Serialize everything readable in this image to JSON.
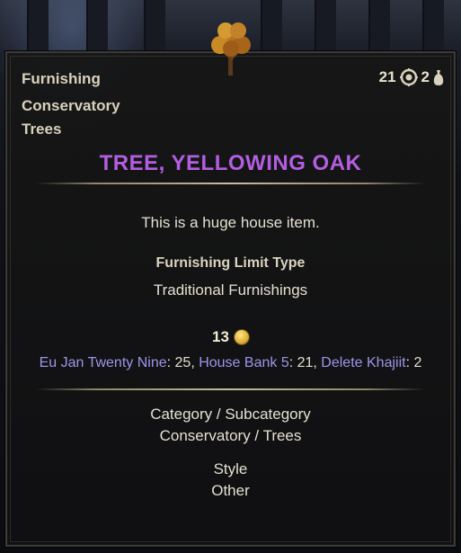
{
  "colors": {
    "title": "#b35ee0",
    "body_text": "#e4e0cf",
    "location_name": "#9b96e8",
    "divider": "#c4bea3",
    "coin": "#e0b33a"
  },
  "icons": {
    "item": "tree-icon",
    "stolen": "ouroboros-icon",
    "bag": "bag-icon",
    "currency": "gold-coin-icon"
  },
  "header": {
    "type": "Furnishing",
    "category": "Conservatory",
    "subcategory": "Trees",
    "count_a": "21",
    "count_b": "2"
  },
  "item": {
    "name": "TREE, YELLOWING OAK",
    "description": "This is a huge house item.",
    "limit_type_label": "Furnishing Limit Type",
    "limit_type_value": "Traditional Furnishings",
    "price": "13"
  },
  "inventory": [
    {
      "name": "Eu Jan Twenty Nine",
      "sep": ": ",
      "count": "25",
      "after": ", "
    },
    {
      "name": "House Bank 5",
      "sep": ": ",
      "count": "21",
      "after": ", "
    },
    {
      "name": "Delete Khajiit",
      "sep": ": ",
      "count": "2",
      "after": ""
    }
  ],
  "details": {
    "category_label": "Category / Subcategory",
    "category_value": "Conservatory / Trees",
    "style_label": "Style",
    "style_value": "Other"
  }
}
